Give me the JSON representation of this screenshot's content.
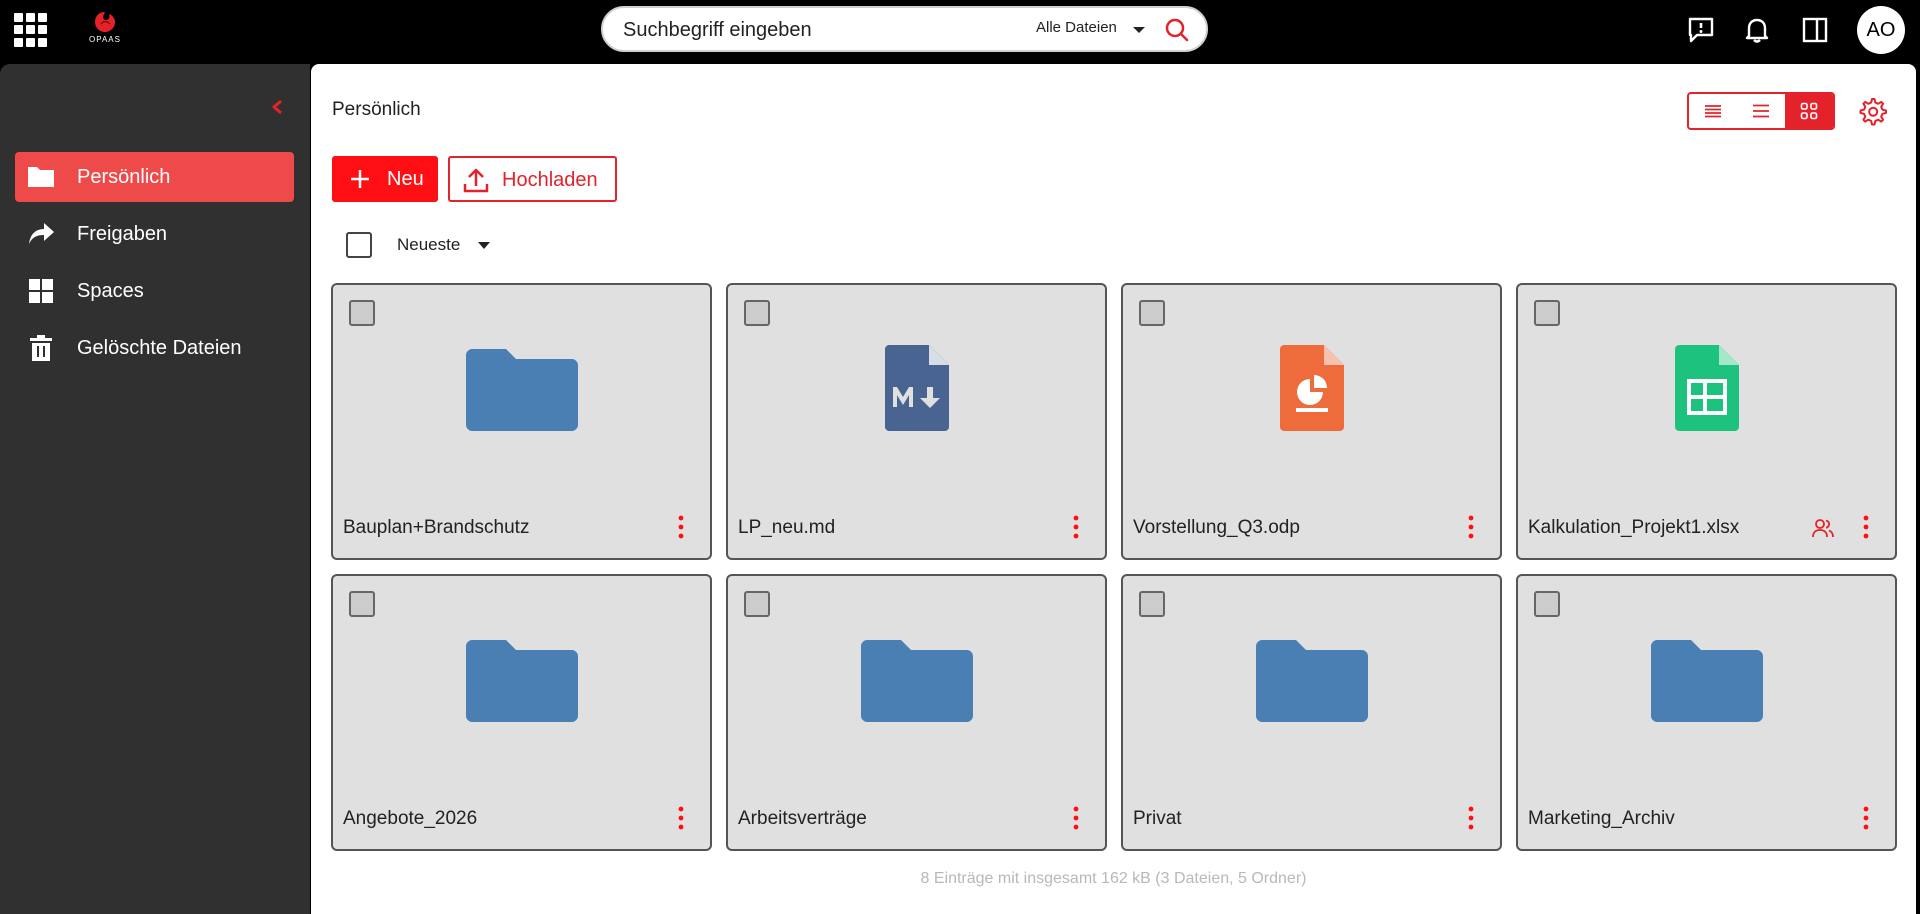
{
  "app": {
    "logo_text": "OPAAS"
  },
  "search": {
    "placeholder": "Suchbegriff eingeben",
    "filter": "Alle Dateien"
  },
  "user": {
    "initials": "AO"
  },
  "sidebar": {
    "items": [
      {
        "label": "Persönlich",
        "icon": "folder-icon",
        "active": true
      },
      {
        "label": "Freigaben",
        "icon": "share-icon",
        "active": false
      },
      {
        "label": "Spaces",
        "icon": "spaces-icon",
        "active": false
      },
      {
        "label": "Gelöschte Dateien",
        "icon": "trash-icon",
        "active": false
      }
    ]
  },
  "main": {
    "breadcrumb": "Persönlich",
    "new_label": "Neu",
    "upload_label": "Hochladen",
    "sort_label": "Neueste",
    "view_modes": [
      "condensed-table",
      "table",
      "tiles"
    ],
    "active_view": "tiles",
    "files": [
      {
        "name": "Bauplan+Brandschutz",
        "type": "folder",
        "shared": false
      },
      {
        "name": "LP_neu.md",
        "type": "markdown",
        "shared": false
      },
      {
        "name": "Vorstellung_Q3.odp",
        "type": "presentation",
        "shared": false
      },
      {
        "name": "Kalkulation_Projekt1.xlsx",
        "type": "spreadsheet",
        "shared": true
      },
      {
        "name": "Angebote_2026",
        "type": "folder",
        "shared": false
      },
      {
        "name": "Arbeitsverträge",
        "type": "folder",
        "shared": false
      },
      {
        "name": "Privat",
        "type": "folder",
        "shared": false
      },
      {
        "name": "Marketing_Archiv",
        "type": "folder",
        "shared": false
      }
    ],
    "summary": "8 Einträge mit insgesamt 162 kB (3 Dateien, 5 Ordner)"
  },
  "colors": {
    "accent": "#e3222a",
    "sidebar_bg": "#303030",
    "active_nav": "#ef4a4a",
    "folder": "#4a7fb4",
    "markdown": "#4a6491",
    "presentation": "#ee6b3c",
    "spreadsheet": "#1ec27f"
  }
}
